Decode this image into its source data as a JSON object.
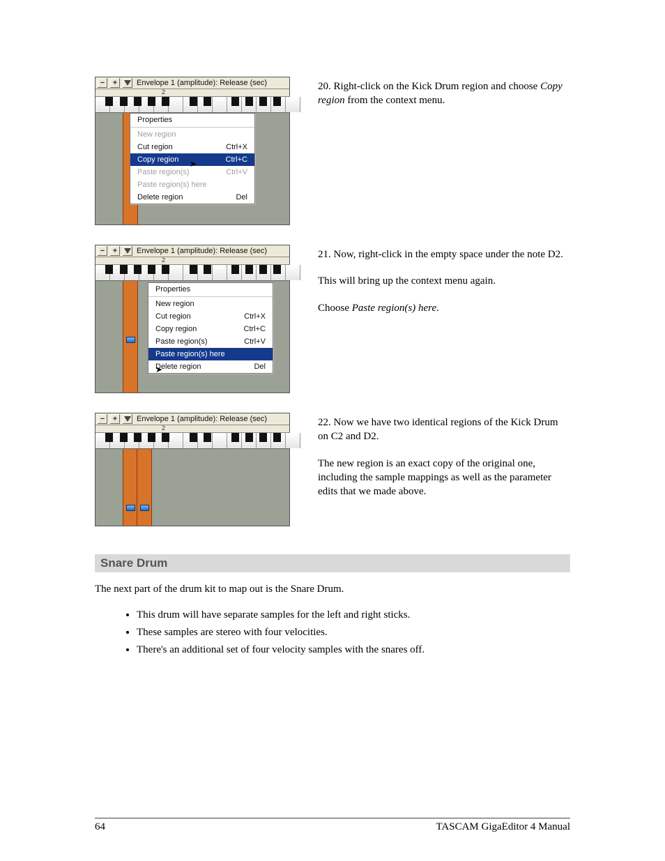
{
  "figureHeader": {
    "minus": "−",
    "plus": "+",
    "title": "Envelope 1 (amplitude): Release (sec)",
    "octaveLabel": "2"
  },
  "menu": {
    "properties": "Properties",
    "newRegion": "New region",
    "cutRegion": "Cut region",
    "cutSc": "Ctrl+X",
    "copyRegion": "Copy region",
    "copySc": "Ctrl+C",
    "pasteRegion": "Paste region(s)",
    "pasteSc": "Ctrl+V",
    "pasteHere": "Paste region(s) here",
    "deleteRegion": "Delete region",
    "deleteSc": "Del"
  },
  "step20": {
    "lead": "20. Right-click on the Kick Drum region and choose ",
    "italic": "Copy region",
    "tail": " from the context menu."
  },
  "step21": {
    "lead": "21. Now, right-click in the empty space under the note D2.",
    "p2": "This will bring up the context menu again.",
    "p3a": "Choose ",
    "p3i": "Paste region(s) here",
    "p3b": "."
  },
  "step22": {
    "lead": "22. Now we have two identical regions of the Kick Drum on C2 and D2.",
    "p2": "The new region is an exact copy of the original one, including the sample mappings as well as the parameter edits that we made above."
  },
  "section": {
    "heading": "Snare Drum",
    "intro": "The next part of the drum kit to map out is the Snare Drum.",
    "b1": "This drum will have separate samples for the left and right sticks.",
    "b2": "These samples are stereo with four velocities.",
    "b3": "There's an additional set of four velocity samples with the snares off."
  },
  "footer": {
    "page": "64",
    "manual": "TASCAM GigaEditor 4 Manual"
  }
}
